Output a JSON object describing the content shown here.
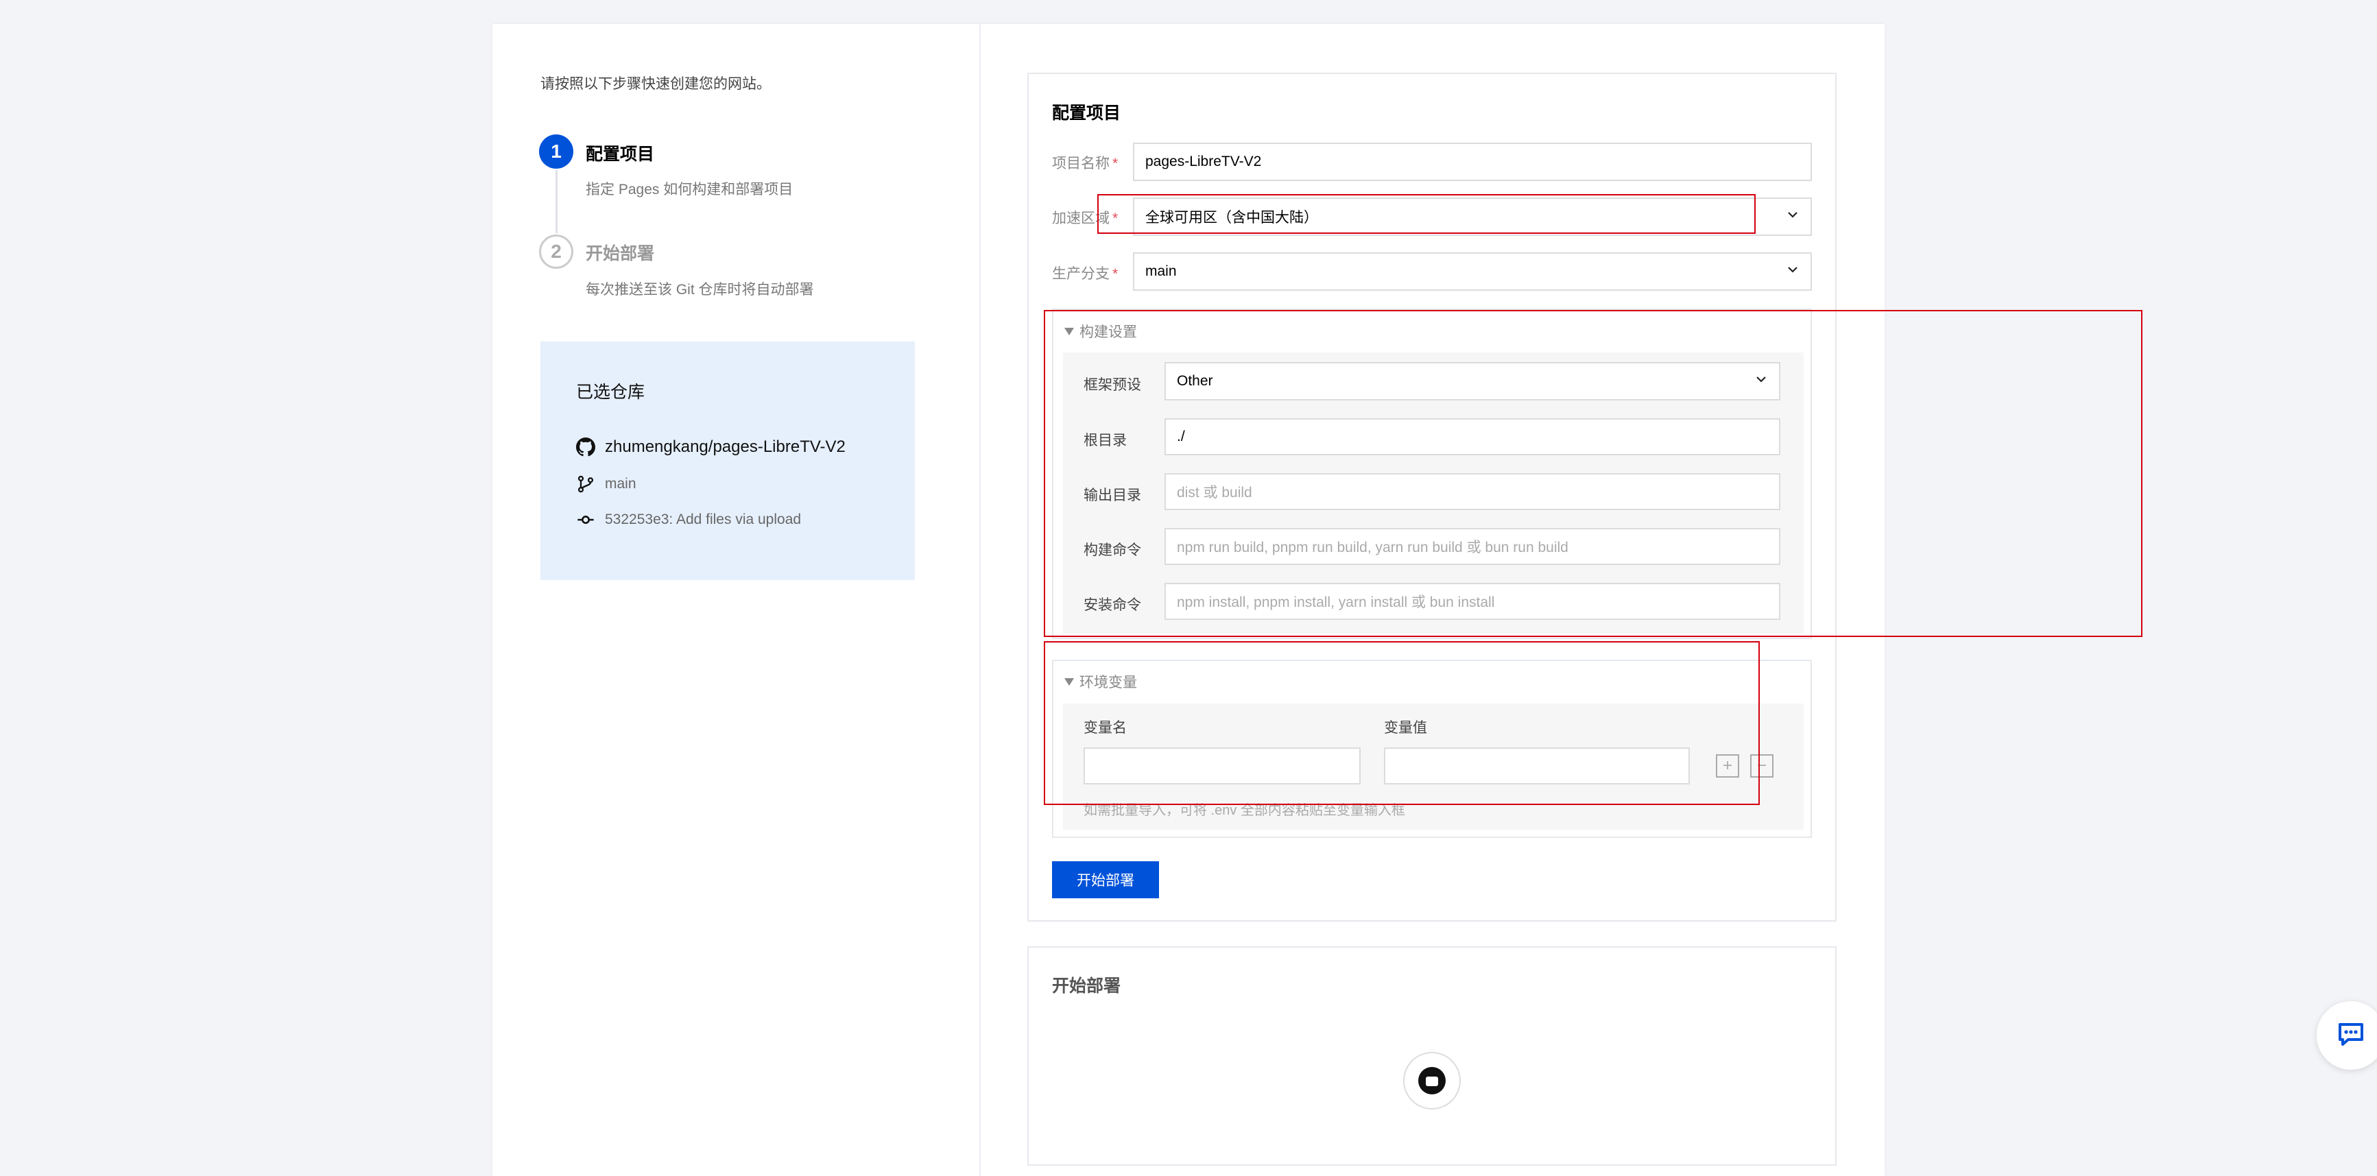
{
  "intro": "请按照以下步骤快速创建您的网站。",
  "steps": [
    {
      "num": "1",
      "title": "配置项目",
      "desc": "指定 Pages 如何构建和部署项目"
    },
    {
      "num": "2",
      "title": "开始部署",
      "desc": "每次推送至该 Git 仓库时将自动部署"
    }
  ],
  "repo": {
    "title": "已选仓库",
    "name": "zhumengkang/pages-LibreTV-V2",
    "branch": "main",
    "commit": "532253e3: Add files via upload"
  },
  "config": {
    "title": "配置项目",
    "project_name_label": "项目名称",
    "project_name_value": "pages-LibreTV-V2",
    "region_label": "加速区域",
    "region_value": "全球可用区（含中国大陆）",
    "branch_label": "生产分支",
    "branch_value": "main",
    "required_mark": "*",
    "build": {
      "title": "构建设置",
      "framework_label": "框架预设",
      "framework_value": "Other",
      "root_label": "根目录",
      "root_value": "./",
      "output_label": "输出目录",
      "output_placeholder": "dist 或 build",
      "build_cmd_label": "构建命令",
      "build_cmd_placeholder": "npm run build, pnpm run build, yarn run build 或 bun run build",
      "install_cmd_label": "安装命令",
      "install_cmd_placeholder": "npm install, pnpm install, yarn install 或 bun install"
    },
    "env": {
      "title": "环境变量",
      "name_label": "变量名",
      "value_label": "变量值",
      "add": "+",
      "remove": "−",
      "hint": "如需批量导入，可将 .env 全部内容粘贴至变量输入框"
    },
    "start_button": "开始部署"
  },
  "deploy": {
    "title": "开始部署"
  },
  "colors": {
    "primary": "#0052d9",
    "annotation_red": "#d4000f",
    "repo_box_bg": "#e6f0fc"
  },
  "icons": [
    "github-icon",
    "branch-icon",
    "commit-icon",
    "chevron-down-icon",
    "chat-icon",
    "loader-icon"
  ]
}
